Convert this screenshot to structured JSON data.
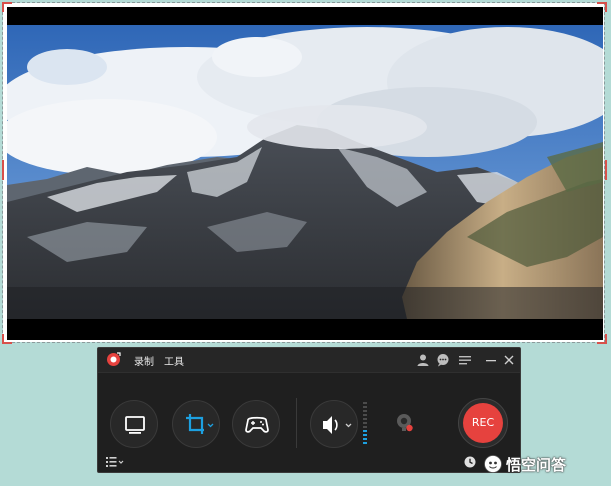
{
  "panel": {
    "menu_record": "录制",
    "menu_tools": "工具",
    "rec_label": "REC"
  },
  "watermark": {
    "text": "悟空问答"
  },
  "colors": {
    "background": "#b4dbd6",
    "panel": "#1f1f1f",
    "accent_blue": "#1da0e0",
    "rec_red": "#e6423e",
    "frame_corner": "#d8504b"
  },
  "icons": {
    "app": "app-logo-icon",
    "user": "user-icon",
    "chat": "chat-icon",
    "menu": "menu-icon",
    "minimize": "minimize-icon",
    "close": "close-icon",
    "screen": "monitor-icon",
    "crop": "crop-icon",
    "game": "gamepad-icon",
    "audio": "speaker-icon",
    "webcam": "webcam-icon",
    "list": "list-icon",
    "clock": "clock-icon"
  }
}
